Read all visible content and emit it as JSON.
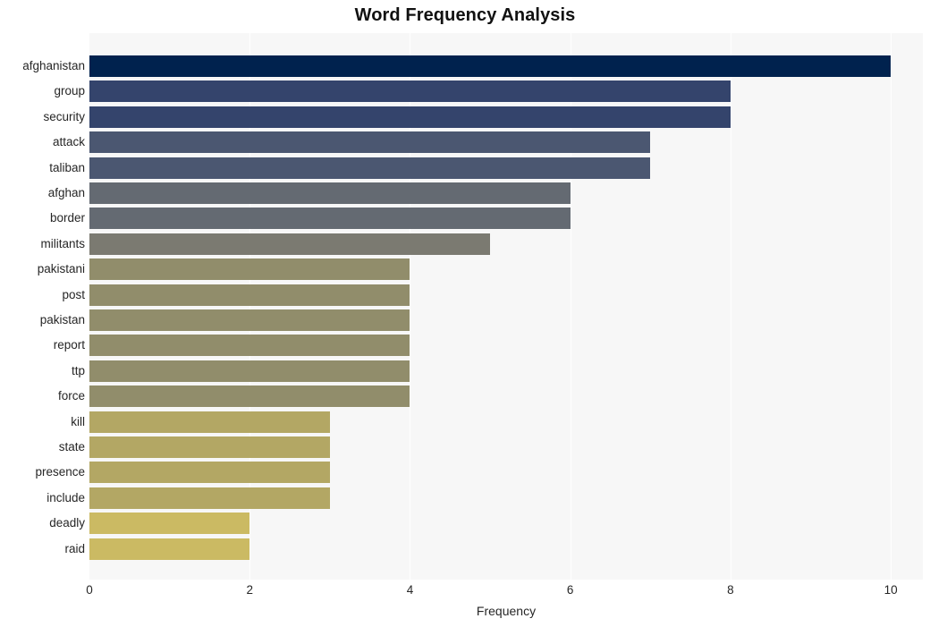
{
  "chart_data": {
    "type": "bar",
    "orientation": "horizontal",
    "title": "Word Frequency Analysis",
    "xlabel": "Frequency",
    "ylabel": "",
    "categories": [
      "afghanistan",
      "group",
      "security",
      "attack",
      "taliban",
      "afghan",
      "border",
      "militants",
      "pakistani",
      "post",
      "pakistan",
      "report",
      "ttp",
      "force",
      "kill",
      "state",
      "presence",
      "include",
      "deadly",
      "raid"
    ],
    "values": [
      10,
      8,
      8,
      7,
      7,
      6,
      6,
      5,
      4,
      4,
      4,
      4,
      4,
      4,
      3,
      3,
      3,
      3,
      2,
      2
    ],
    "bar_colors": [
      "#00224e",
      "#34446c",
      "#34446c",
      "#4b5771",
      "#4b5771",
      "#646a72",
      "#646a72",
      "#7b7a71",
      "#918d6b",
      "#918d6b",
      "#918d6b",
      "#918d6b",
      "#918d6b",
      "#918d6b",
      "#b3a764",
      "#b3a764",
      "#b3a764",
      "#b3a764",
      "#cbba63",
      "#cbba63"
    ],
    "xlim": [
      0,
      10.4
    ],
    "x_ticks": [
      0,
      2,
      4,
      6,
      8,
      10
    ],
    "x_tick_labels": [
      "0",
      "2",
      "4",
      "6",
      "8",
      "10"
    ],
    "grid": true,
    "grid_axis": "x",
    "grid_color": "#ffffff",
    "plot_background": "#f7f7f7",
    "figure_background": "#ffffff",
    "legend": null
  }
}
